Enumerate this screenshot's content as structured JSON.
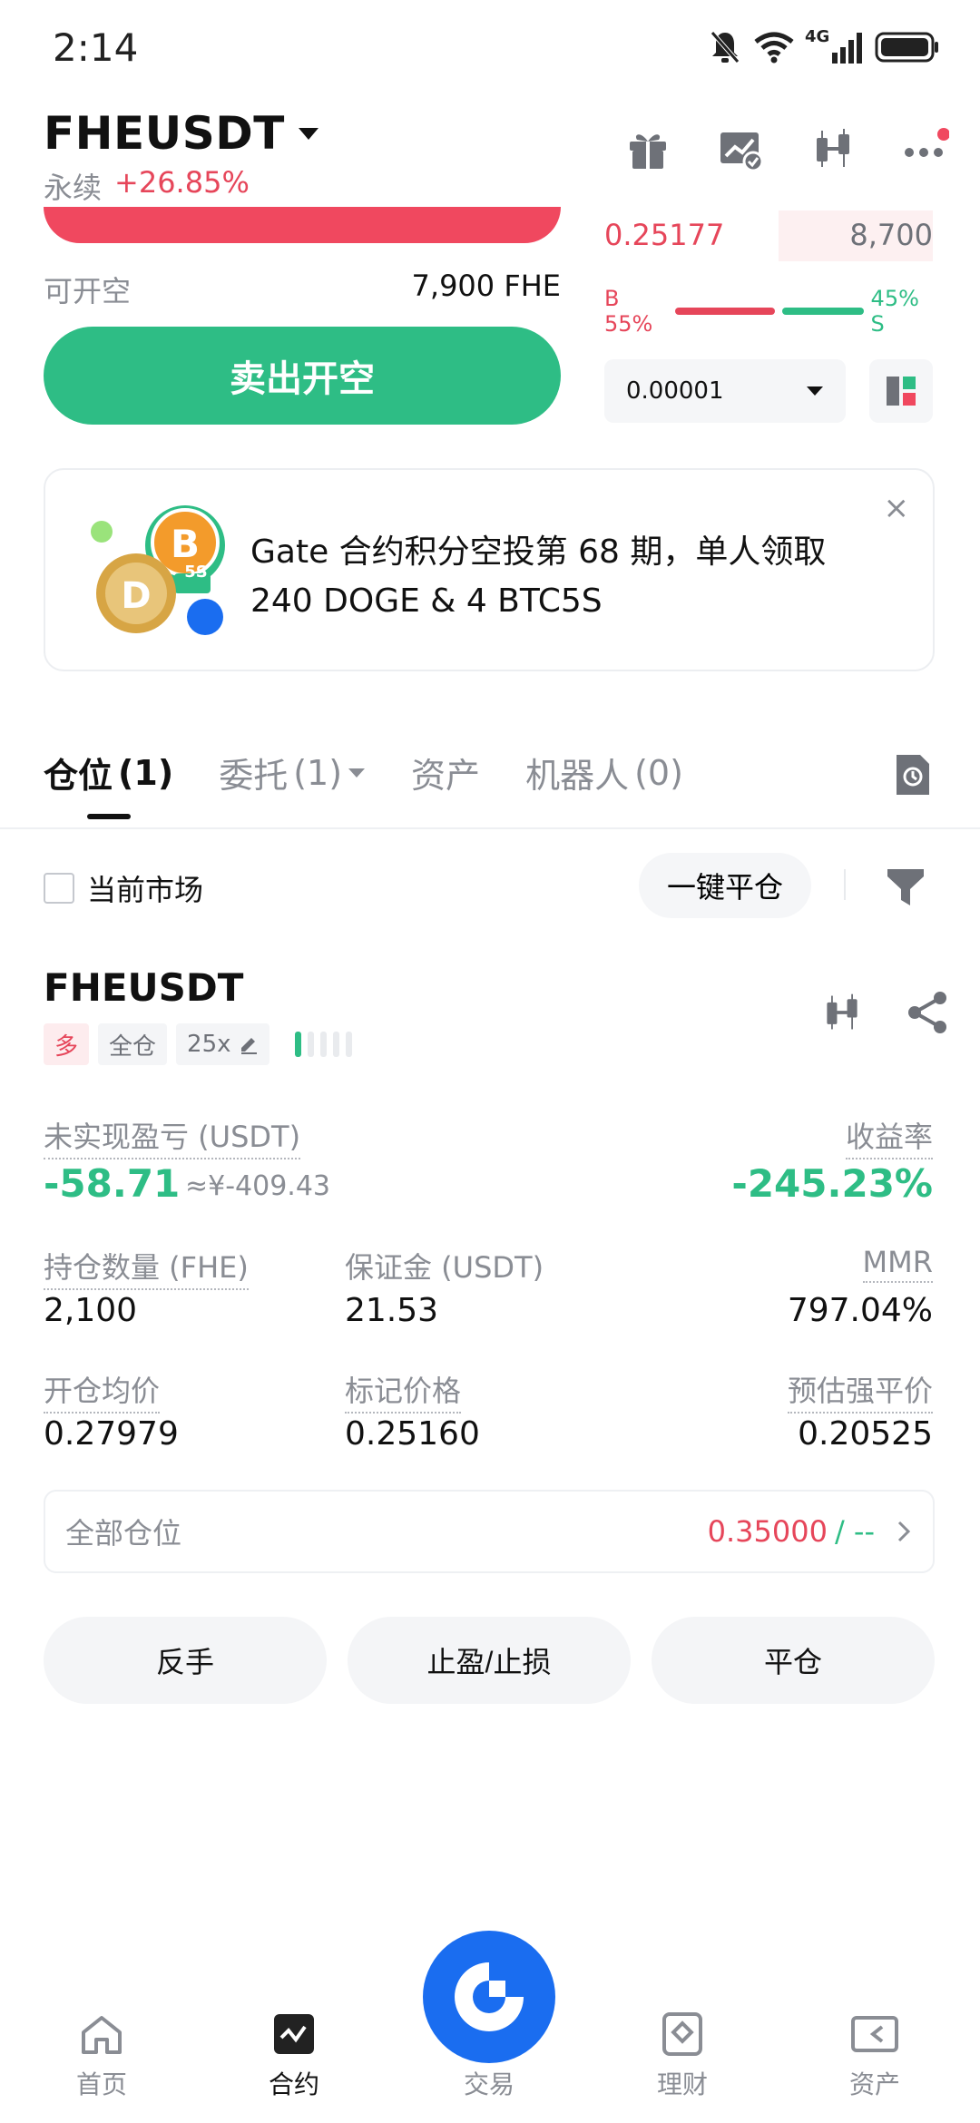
{
  "status_bar": {
    "time": "2:14",
    "network": "4G"
  },
  "header": {
    "pair": "FHEUSDT",
    "contract_type": "永续",
    "change": "+26.85%",
    "icons": [
      "gift-icon",
      "chart-check-icon",
      "candlestick-icon",
      "more-icon"
    ]
  },
  "trade_panel": {
    "open_short_label": "可开空",
    "open_short_value": "7,900 FHE",
    "sell_button": "卖出开空"
  },
  "order_book": {
    "ask_price": "0.25177",
    "ask_qty": "8,700",
    "buy_ratio_label": "B 55%",
    "sell_ratio_label": "45% S",
    "buy_ratio": 0.55,
    "precision": "0.00001"
  },
  "banner": {
    "text": "Gate 合约积分空投第 68 期，单人领取 240 DOGE & 4 BTC5S",
    "badge": "5S",
    "close": "×"
  },
  "tabs": [
    {
      "label": "仓位",
      "count": "(1)"
    },
    {
      "label": "委托",
      "count": "(1)"
    },
    {
      "label": "资产",
      "count": ""
    },
    {
      "label": "机器人",
      "count": "(0)"
    }
  ],
  "filter": {
    "current_market": "当前市场",
    "close_all": "一键平仓"
  },
  "position": {
    "symbol": "FHEUSDT",
    "side": "多",
    "margin_mode": "全仓",
    "leverage": "25x",
    "unrealized_pnl_label": "未实现盈亏 (USDT)",
    "unrealized_pnl": "-58.71",
    "unrealized_pnl_cny": "≈¥-409.43",
    "roe_label": "收益率",
    "roe": "-245.23%",
    "size_label": "持仓数量 (FHE)",
    "size": "2,100",
    "margin_label": "保证金 (USDT)",
    "margin": "21.53",
    "mmr_label": "MMR",
    "mmr": "797.04%",
    "entry_label": "开仓均价",
    "entry": "0.27979",
    "mark_label": "标记价格",
    "mark": "0.25160",
    "liq_label": "预估强平价",
    "liq": "0.20525",
    "all_positions_label": "全部仓位",
    "tp_value": "0.35000",
    "sl_value": "/ --"
  },
  "actions": {
    "reverse": "反手",
    "tp_sl": "止盈/止损",
    "close": "平仓"
  },
  "bottom_nav": [
    {
      "label": "首页",
      "icon": "home-icon"
    },
    {
      "label": "合约",
      "icon": "futures-icon"
    },
    {
      "label": "交易",
      "icon": "gate-logo-icon"
    },
    {
      "label": "理财",
      "icon": "earn-icon"
    },
    {
      "label": "资产",
      "icon": "wallet-icon"
    }
  ],
  "colors": {
    "green": "#2ebd85",
    "red": "#e6465a",
    "orange": "#f0913c",
    "brand_blue": "#1a6df0"
  }
}
